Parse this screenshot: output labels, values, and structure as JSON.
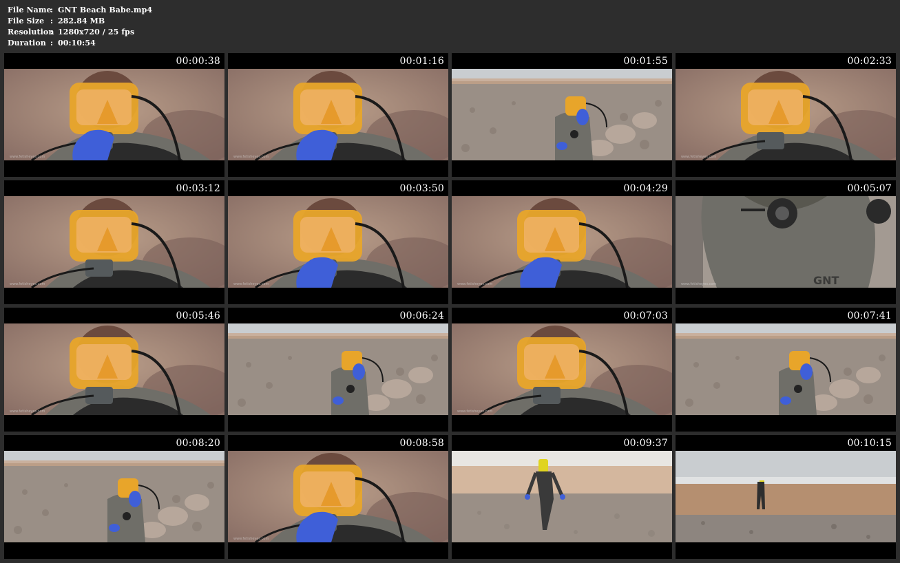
{
  "file_info": {
    "rows": [
      {
        "label": "File Name",
        "sep": ":",
        "value": "GNT Beach Babe.mp4"
      },
      {
        "label": "File Size",
        "sep": ":",
        "value": "282.84 MB"
      },
      {
        "label": "Resolution",
        "sep": ":",
        "value": "1280x720 / 25 fps"
      },
      {
        "label": "Duration",
        "sep": ":",
        "value": "00:10:54"
      }
    ]
  },
  "thumbnails": [
    {
      "time": "00:00:38",
      "scene": "closeup",
      "gloved_hand": true
    },
    {
      "time": "00:01:16",
      "scene": "closeup",
      "gloved_hand": true
    },
    {
      "time": "00:01:55",
      "scene": "beach-seated",
      "gloved_hand": true
    },
    {
      "time": "00:02:33",
      "scene": "closeup",
      "gloved_hand": false
    },
    {
      "time": "00:03:12",
      "scene": "closeup",
      "gloved_hand": false
    },
    {
      "time": "00:03:50",
      "scene": "closeup",
      "gloved_hand": true
    },
    {
      "time": "00:04:29",
      "scene": "closeup",
      "gloved_hand": true
    },
    {
      "time": "00:05:07",
      "scene": "drysuit-chest",
      "gloved_hand": false
    },
    {
      "time": "00:05:46",
      "scene": "closeup",
      "gloved_hand": false
    },
    {
      "time": "00:06:24",
      "scene": "beach-seated",
      "gloved_hand": true
    },
    {
      "time": "00:07:03",
      "scene": "closeup",
      "gloved_hand": false
    },
    {
      "time": "00:07:41",
      "scene": "beach-seated",
      "gloved_hand": true
    },
    {
      "time": "00:08:20",
      "scene": "beach-seated",
      "gloved_hand": true
    },
    {
      "time": "00:08:58",
      "scene": "closeup",
      "gloved_hand": true
    },
    {
      "time": "00:09:37",
      "scene": "beach-walking",
      "gloved_hand": false
    },
    {
      "time": "00:10:15",
      "scene": "beach-far",
      "gloved_hand": false
    }
  ],
  "colors": {
    "background": "#2d2d2d",
    "mask_yellow": "#e8a52a",
    "glove_blue": "#3f5fd8",
    "drysuit_gray": "#6f6e68",
    "sand": "#b59b86",
    "pebble": "#9a8f86",
    "sea": "#c9cdd0"
  }
}
